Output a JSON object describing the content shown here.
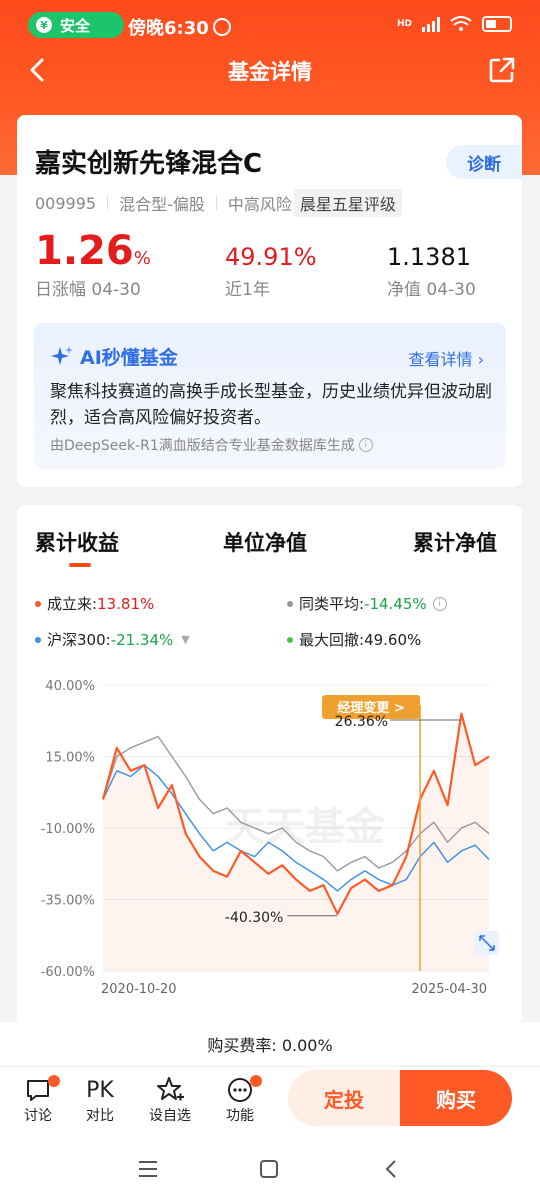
{
  "status_bar": {
    "safe_label": "安全",
    "time": "傍晚6:30",
    "net_label": "HD"
  },
  "nav": {
    "title": "基金详情"
  },
  "fund": {
    "name": "嘉实创新先锋混合C",
    "diagnose_label": "诊断",
    "code": "009995",
    "type": "混合型-偏股",
    "risk": "中高风险",
    "rating": "晨星五星评级",
    "daily_change_value": "1.26",
    "daily_change_unit": "%",
    "daily_change_label": "日涨幅 04-30",
    "year_return": "49.91%",
    "year_return_label": "近1年",
    "nav_value": "1.1381",
    "nav_label": "净值 04-30"
  },
  "ai": {
    "title": "AI秒懂基金",
    "link": "查看详情",
    "text": "聚焦科技赛道的高换手成长型基金，历史业绩优异但波动剧烈，适合高风险偏好投资者。",
    "note": "由DeepSeek-R1满血版结合专业基金数据库生成"
  },
  "chart_tabs": [
    "累计收益",
    "单位净值",
    "累计净值"
  ],
  "legend": {
    "since_inception_label": "成立来:",
    "since_inception_value": "13.81%",
    "peer_avg_label": "同类平均:",
    "peer_avg_value": "-14.45%",
    "hs300_label": "沪深300:",
    "hs300_value": "-21.34%",
    "max_drawdown_label": "最大回撤:",
    "max_drawdown_value": "49.60%"
  },
  "chart_data": {
    "type": "line",
    "x_start": "2020-10-20",
    "x_end": "2025-04-30",
    "y_ticks": [
      "40.00%",
      "15.00%",
      "-10.00%",
      "-35.00%",
      "-60.00%"
    ],
    "ylim": [
      -60,
      40
    ],
    "annotations": {
      "manager_change": "经理变更 >",
      "peak_label": "26.36%",
      "trough_label": "-40.30%",
      "watermark": "天天基金"
    },
    "series": [
      {
        "name": "成立来",
        "color": "#ff5a26",
        "values": [
          0,
          18,
          10,
          12,
          -3,
          5,
          -12,
          -20,
          -25,
          -27,
          -18,
          -22,
          -26,
          -23,
          -28,
          -32,
          -30,
          -40,
          -31,
          -28,
          -32,
          -30,
          -20,
          0,
          10,
          -2,
          30,
          12,
          15
        ]
      },
      {
        "name": "同类平均",
        "color": "#999999",
        "values": [
          0,
          15,
          18,
          20,
          22,
          15,
          8,
          0,
          -5,
          -3,
          -8,
          -10,
          -12,
          -10,
          -15,
          -18,
          -20,
          -25,
          -22,
          -20,
          -24,
          -22,
          -18,
          -12,
          -8,
          -15,
          -10,
          -8,
          -12
        ]
      },
      {
        "name": "沪深300",
        "color": "#3a8ee6",
        "values": [
          0,
          10,
          8,
          12,
          8,
          2,
          -5,
          -12,
          -18,
          -15,
          -18,
          -20,
          -15,
          -18,
          -22,
          -25,
          -28,
          -32,
          -28,
          -25,
          -28,
          -30,
          -28,
          -20,
          -15,
          -22,
          -18,
          -16,
          -21
        ]
      }
    ]
  },
  "bottom": {
    "fee_label": "购买费率:",
    "fee_value": "0.00%",
    "discuss": "讨论",
    "pk_icon_text": "PK",
    "compare": "对比",
    "watchlist": "设自选",
    "functions": "功能",
    "auto_invest": "定投",
    "buy": "购买"
  },
  "colors": {
    "brand": "#ff4a1c",
    "up": "#e41c1c",
    "down": "#1aa34a",
    "ai_blue": "#2f6ee5"
  }
}
